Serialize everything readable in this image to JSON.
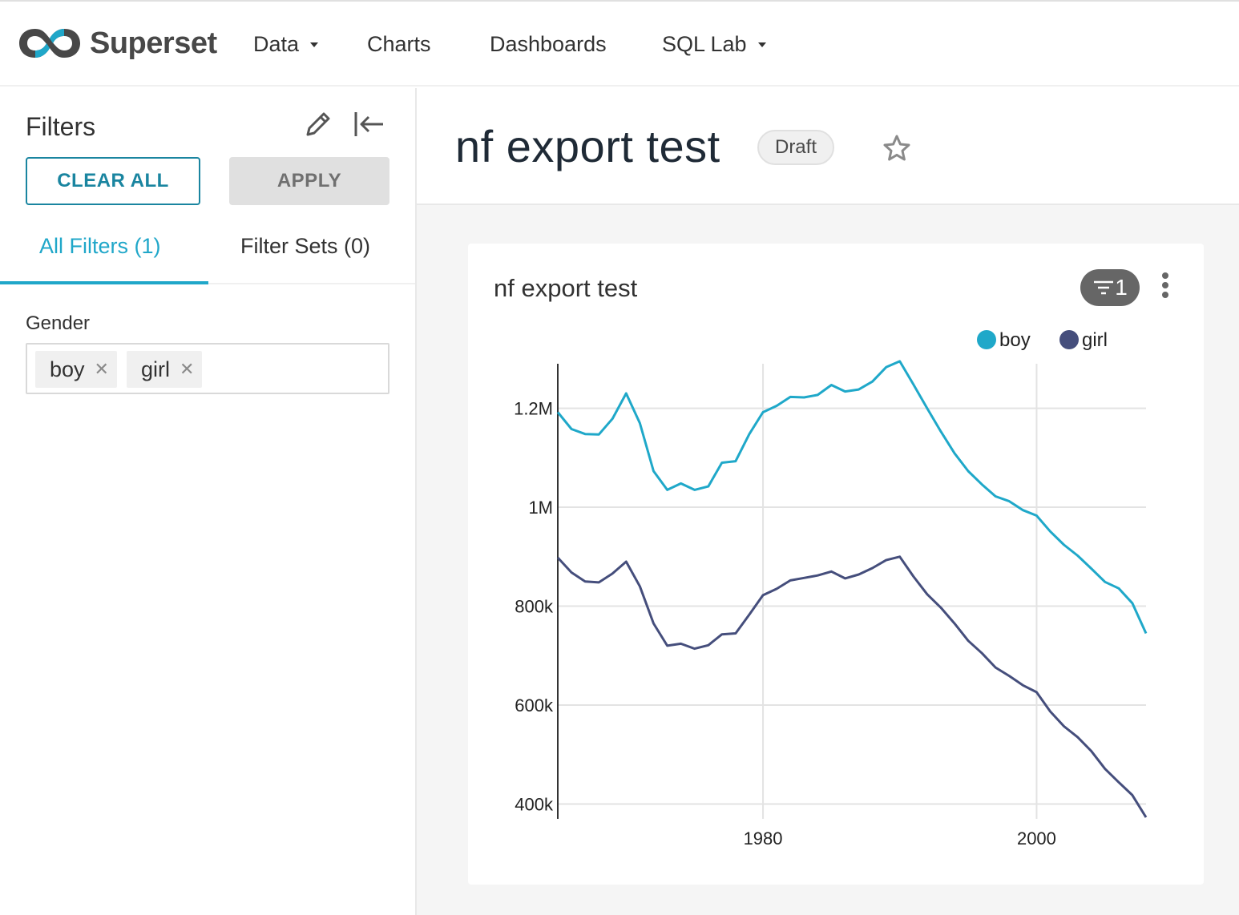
{
  "nav": {
    "brand": "Superset",
    "items": [
      {
        "label": "Data",
        "dropdown": true
      },
      {
        "label": "Charts",
        "dropdown": false
      },
      {
        "label": "Dashboards",
        "dropdown": false
      },
      {
        "label": "SQL Lab",
        "dropdown": true
      }
    ]
  },
  "sidebar": {
    "title": "Filters",
    "clear_label": "CLEAR ALL",
    "apply_label": "APPLY",
    "tabs": [
      {
        "label": "All Filters (1)",
        "active": true
      },
      {
        "label": "Filter Sets (0)",
        "active": false
      }
    ],
    "filter": {
      "label": "Gender",
      "selected": [
        "boy",
        "girl"
      ]
    }
  },
  "dashboard": {
    "title": "nf export test",
    "status": "Draft",
    "favorite": false
  },
  "chart": {
    "title": "nf export test",
    "filter_count": "1",
    "icons": {
      "filter_badge": "filter-icon",
      "menu": "more-vert-icon"
    }
  },
  "colors": {
    "accent": "#20a7c9",
    "boy": "#1fa8c9",
    "girl": "#454e7c"
  },
  "chart_data": {
    "type": "line",
    "title": "nf export test",
    "xlabel": "",
    "ylabel": "",
    "legend_position": "top-right",
    "grid": true,
    "xlim": [
      1965,
      2008
    ],
    "ylim": [
      370000,
      1290000
    ],
    "x_ticks": [
      1980,
      2000
    ],
    "x_tick_labels": [
      "1980",
      "2000"
    ],
    "y_ticks": [
      400000,
      600000,
      800000,
      1000000,
      1200000
    ],
    "y_tick_labels": [
      "400k",
      "600k",
      "800k",
      "1M",
      "1.2M"
    ],
    "x": [
      1965,
      1966,
      1967,
      1968,
      1969,
      1970,
      1971,
      1972,
      1973,
      1974,
      1975,
      1976,
      1977,
      1978,
      1979,
      1980,
      1981,
      1982,
      1983,
      1984,
      1985,
      1986,
      1987,
      1988,
      1989,
      1990,
      1991,
      1992,
      1993,
      1994,
      1995,
      1996,
      1997,
      1998,
      1999,
      2000,
      2001,
      2002,
      2003,
      2004,
      2005,
      2006,
      2007,
      2008
    ],
    "series": [
      {
        "name": "boy",
        "values": [
          1192000,
          1158000,
          1148000,
          1147000,
          1179000,
          1230000,
          1170000,
          1073000,
          1035000,
          1048000,
          1035000,
          1042000,
          1090000,
          1093000,
          1148000,
          1192000,
          1205000,
          1223000,
          1222000,
          1227000,
          1247000,
          1234000,
          1238000,
          1254000,
          1283000,
          1295000,
          1248000,
          1200000,
          1153000,
          1109000,
          1073000,
          1046000,
          1022000,
          1012000,
          994000,
          983000,
          951000,
          924000,
          902000,
          876000,
          849000,
          836000,
          806000,
          745000
        ]
      },
      {
        "name": "girl",
        "values": [
          898000,
          868000,
          850000,
          848000,
          866000,
          890000,
          840000,
          765000,
          720000,
          724000,
          714000,
          721000,
          743000,
          745000,
          783000,
          822000,
          835000,
          852000,
          857000,
          862000,
          870000,
          856000,
          864000,
          877000,
          893000,
          900000,
          860000,
          824000,
          797000,
          765000,
          730000,
          705000,
          676000,
          659000,
          640000,
          626000,
          587000,
          557000,
          535000,
          507000,
          471000,
          444000,
          418000,
          373000
        ]
      }
    ]
  }
}
